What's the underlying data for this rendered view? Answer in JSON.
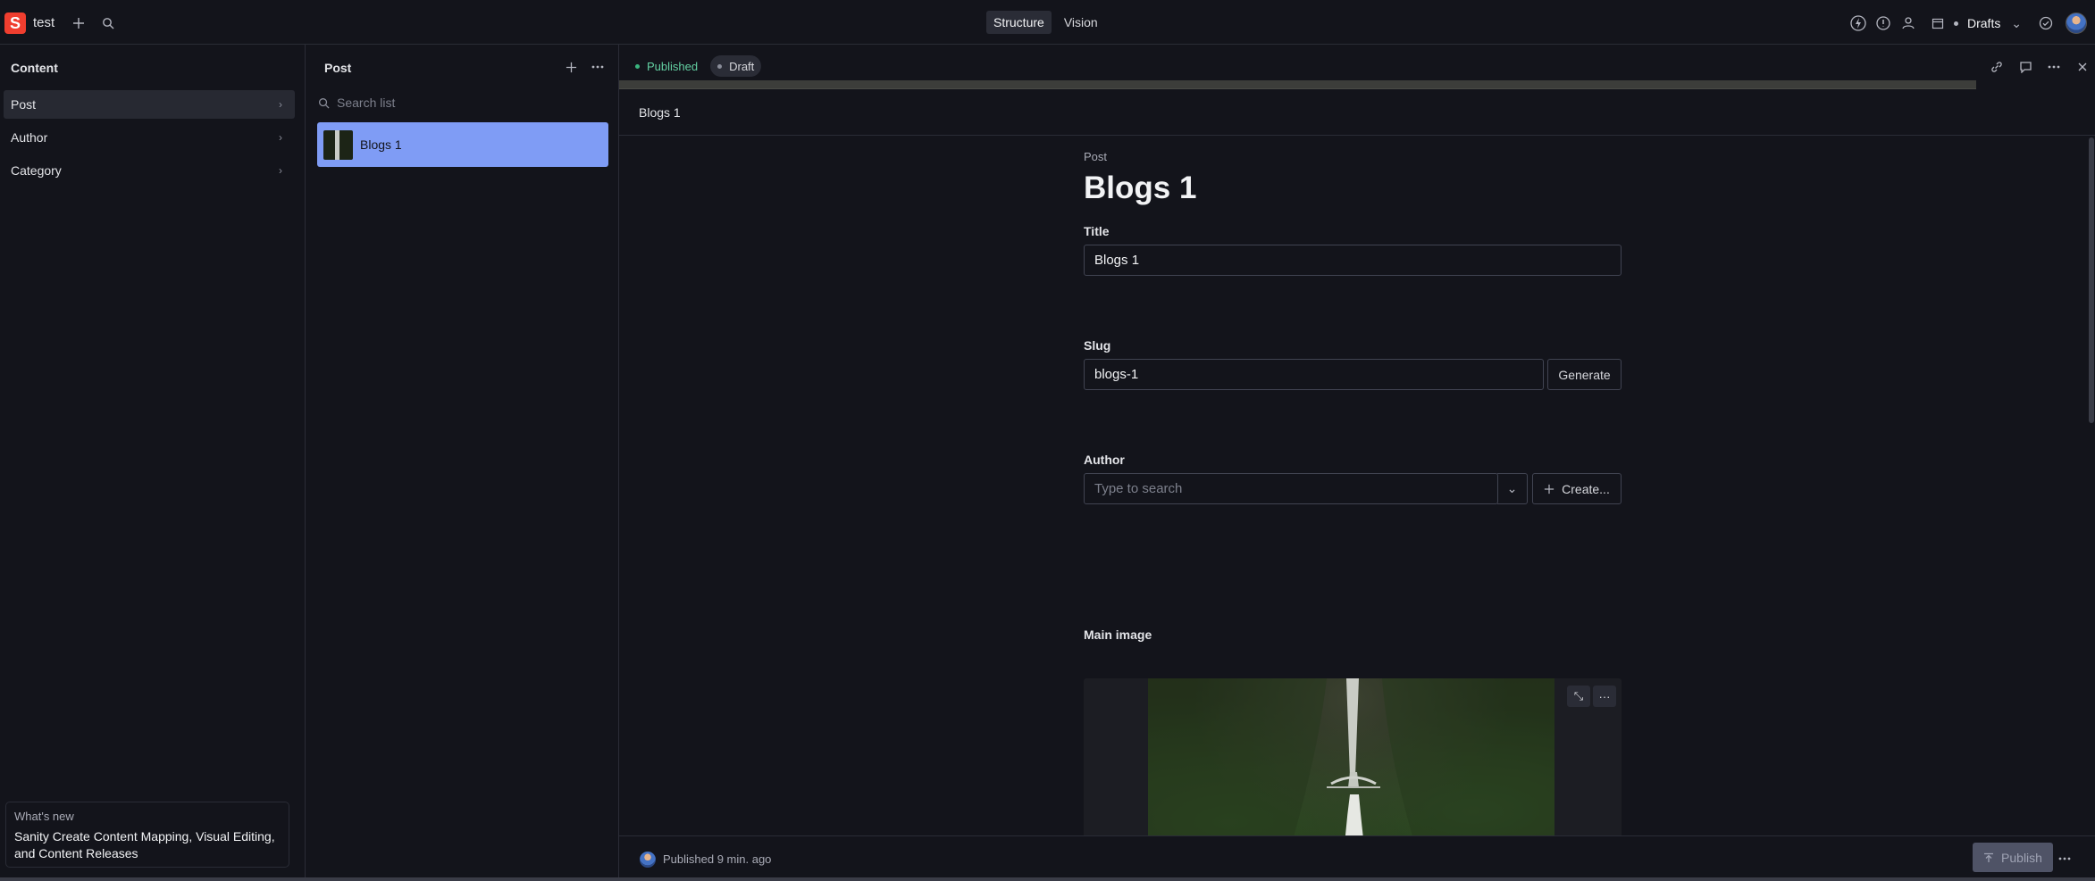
{
  "navbar": {
    "logo_letter": "S",
    "workspace": "test",
    "tools": [
      "Structure",
      "Vision"
    ],
    "release_selector": "Drafts"
  },
  "sidebar": {
    "title": "Content",
    "items": [
      {
        "label": "Post"
      },
      {
        "label": "Author"
      },
      {
        "label": "Category"
      }
    ],
    "whats_new": {
      "heading": "What's new",
      "body": "Sanity Create Content Mapping, Visual Editing, and Content Releases"
    }
  },
  "list": {
    "title": "Post",
    "search_placeholder": "Search list",
    "documents": [
      {
        "label": "Blogs 1"
      }
    ]
  },
  "editor": {
    "status_published": "Published",
    "status_draft": "Draft",
    "header_title": "Blogs 1",
    "doc_type": "Post",
    "doc_title": "Blogs 1",
    "fields": {
      "title": {
        "label": "Title",
        "value": "Blogs 1"
      },
      "slug": {
        "label": "Slug",
        "value": "blogs-1",
        "button": "Generate"
      },
      "author": {
        "label": "Author",
        "placeholder": "Type to search",
        "create_button": "Create..."
      },
      "main_image": {
        "label": "Main image"
      }
    },
    "footer": {
      "status": "Published 9 min. ago",
      "publish_button": "Publish"
    }
  },
  "colors": {
    "background": "#13141b",
    "brand": "#f03e2f",
    "selected_doc": "#7f9cf5",
    "published": "#3ab47e"
  }
}
